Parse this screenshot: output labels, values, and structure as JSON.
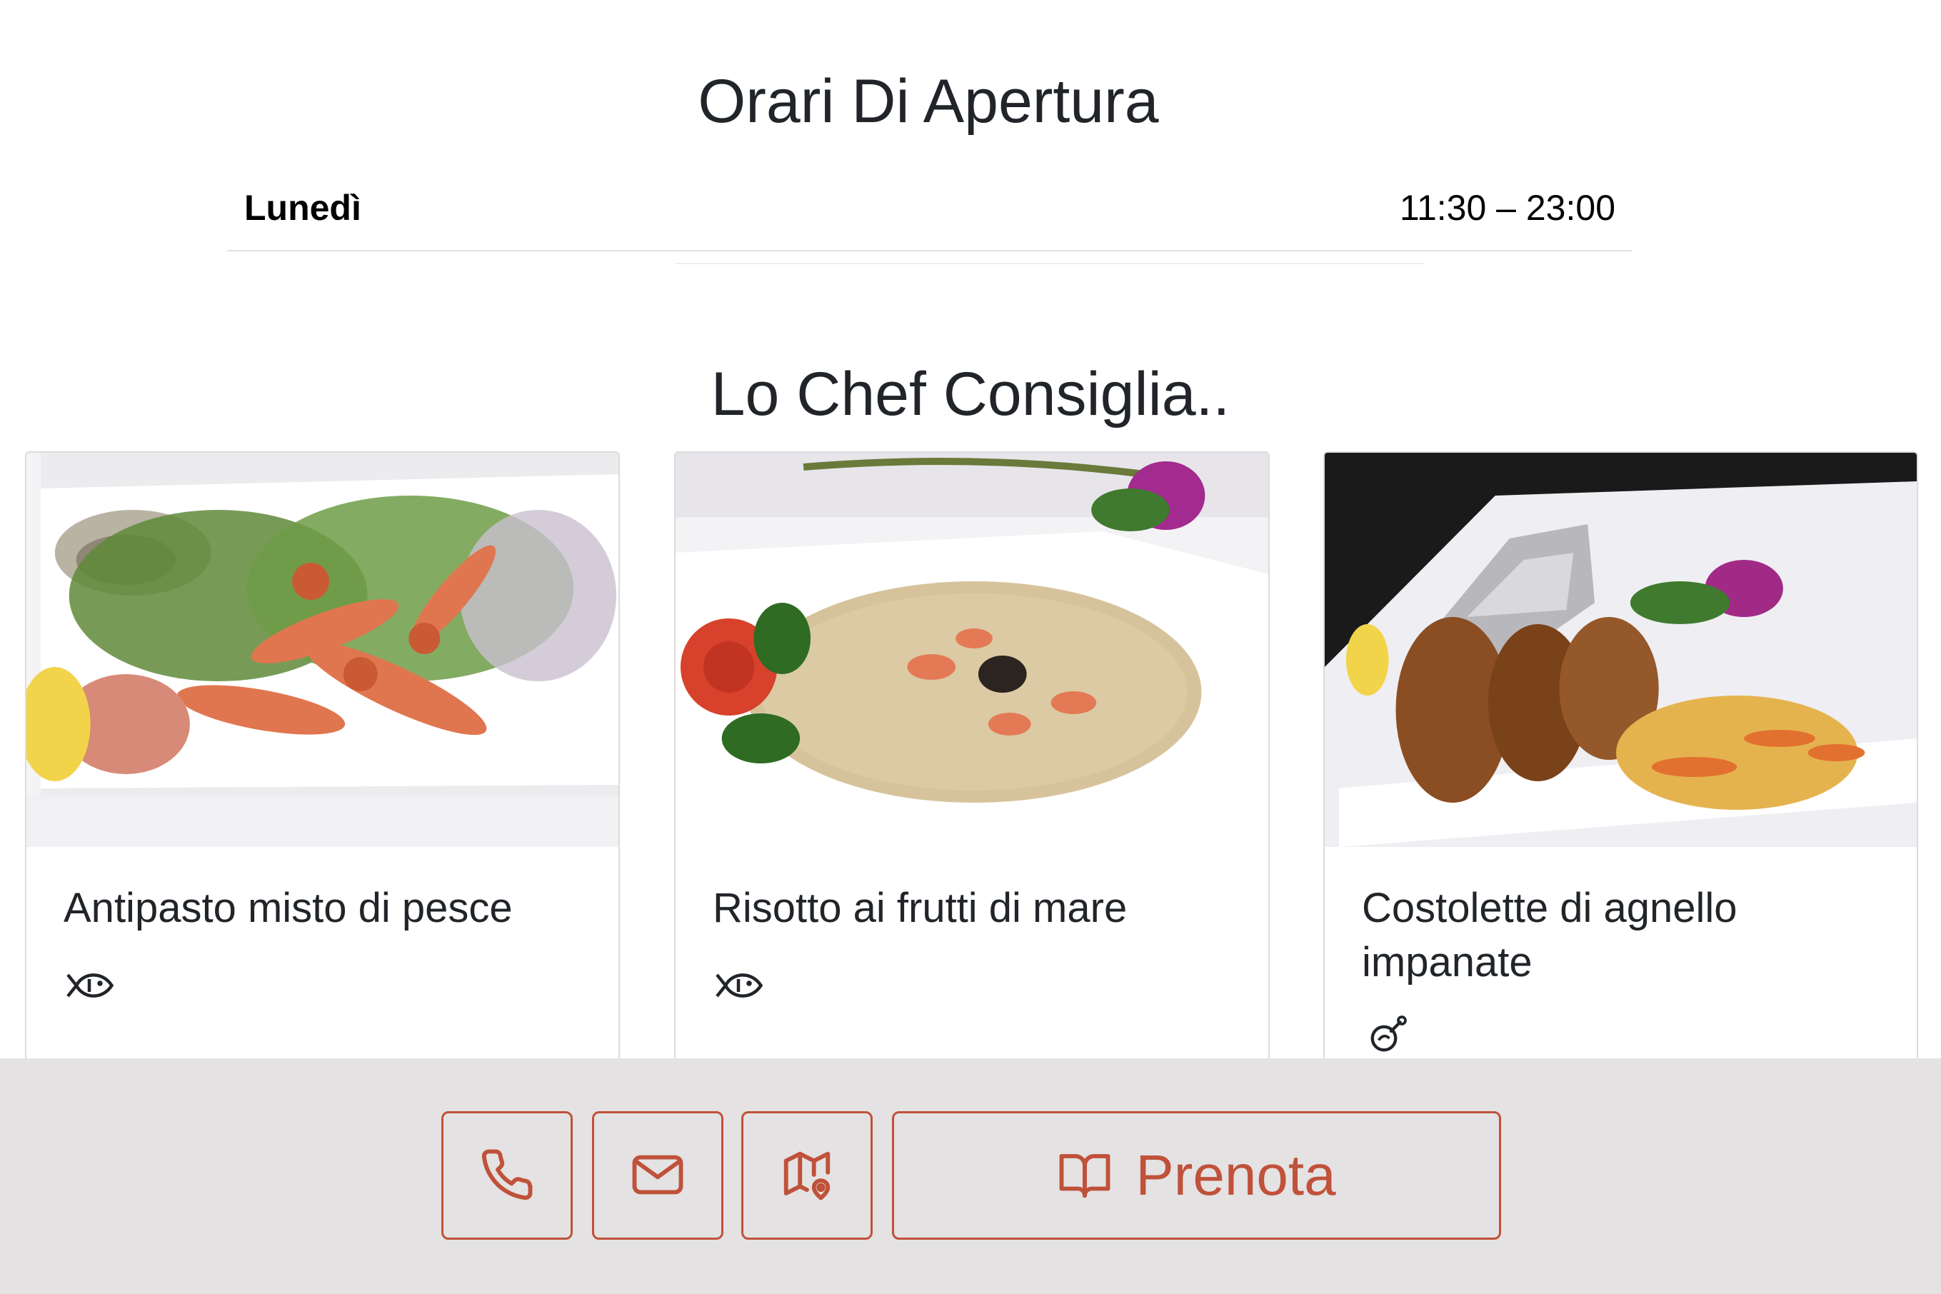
{
  "opening_hours": {
    "title": "Orari Di Apertura",
    "rows": [
      {
        "day": "Lunedì",
        "time": "11:30 – 23:00"
      }
    ]
  },
  "chef_section": {
    "title": "Lo Chef Consiglia..",
    "cards": [
      {
        "title": "Antipasto misto di pesce",
        "icon": "fish-icon"
      },
      {
        "title": "Risotto ai frutti di mare",
        "icon": "fish-icon"
      },
      {
        "title": "Costolette di agnello impanate",
        "icon": "meat-drumstick-icon"
      }
    ]
  },
  "action_bar": {
    "phone_icon": "phone-icon",
    "mail_icon": "mail-icon",
    "map_icon": "map-pin-icon",
    "book_icon": "book-open-icon",
    "book_label": "Prenota"
  },
  "colors": {
    "accent": "#c0513a",
    "bar_background": "#e4e2e2"
  }
}
